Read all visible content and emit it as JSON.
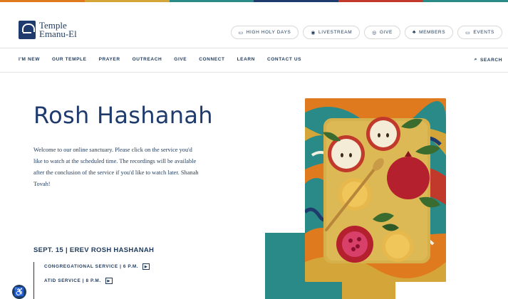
{
  "colors": {
    "primary": "#1f3a5c",
    "teal": "#2a8a88",
    "gold": "#d4a63a",
    "stripe": [
      "#e07a1f",
      "#d4a63a",
      "#2a8a88",
      "#1f3a6c",
      "#c0392b",
      "#2a8a88"
    ]
  },
  "brand": {
    "line1": "Temple",
    "line2": "Emanu-El"
  },
  "util_nav": [
    {
      "label": "HIGH HOLY DAYS",
      "icon": "calendar-icon"
    },
    {
      "label": "LIVESTREAM",
      "icon": "play-circle-icon"
    },
    {
      "label": "GIVE",
      "icon": "heart-icon"
    },
    {
      "label": "MEMBERS",
      "icon": "people-icon"
    },
    {
      "label": "EVENTS",
      "icon": "calendar-icon"
    }
  ],
  "main_nav": [
    "I'M NEW",
    "OUR TEMPLE",
    "PRAYER",
    "OUTREACH",
    "GIVE",
    "CONNECT",
    "LEARN",
    "CONTACT US"
  ],
  "search_label": "SEARCH",
  "hero": {
    "title": "Rosh Hashanah",
    "description": "Welcome to our online sanctuary. Please click on the service you'd like to watch at the scheduled time. The recordings will be available after the conclusion of the service if you'd like to watch later. Shanah Tovah!"
  },
  "schedule": {
    "heading": "SEPT. 15 | EREV ROSH HASHANAH",
    "services": [
      {
        "label": "CONGREGATIONAL SERVICE | 6 P.M."
      },
      {
        "label": "ATID SERVICE | 8 P.M."
      }
    ]
  }
}
